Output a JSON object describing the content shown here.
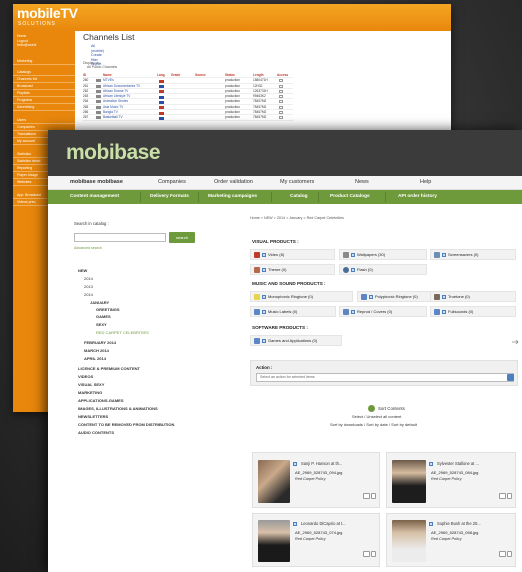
{
  "back_window": {
    "logo_main": "mobile",
    "logo_tv": "TV",
    "logo_sub": "SOLUTIONS",
    "side_top": [
      "Home",
      "Logout",
      "hello@world"
    ],
    "side_items": [
      "Marketing",
      "Catalogs",
      "Channels list",
      "Broadcast",
      "Playlists",
      "Programs",
      "Advertising",
      "Users",
      "Companies",
      "Translations",
      "My account",
      "Statistics",
      "Statistics detail",
      "Reporting",
      "Player Usage",
      "Websites",
      "App: Broadcast",
      "Videos prev."
    ],
    "page_title": "Channels List",
    "top_links": [
      "All (mobile)",
      "Create filter",
      "Export"
    ],
    "display_label": "Display on:",
    "display_value": "All Public Channels",
    "columns": [
      "ID",
      "Name",
      "Lang.",
      "Grade",
      "Source",
      "Status",
      "Length",
      "Access"
    ],
    "rows": [
      {
        "id": "260",
        "name": "MTV8's",
        "status": "production",
        "length": "1580471H"
      },
      {
        "id": "261",
        "name": "African Documentaries TV",
        "status": "production",
        "length": "12H32"
      },
      {
        "id": "262",
        "name": "African Drama TV",
        "status": "production",
        "length": "1263731H"
      },
      {
        "id": "263",
        "name": "African Lifestyle TV",
        "status": "production",
        "length": "99463K2"
      },
      {
        "id": "264",
        "name": "Animation Stories",
        "status": "production",
        "length": "78457M2"
      },
      {
        "id": "265",
        "name": "Asia Music TV",
        "status": "production",
        "length": "78457M2"
      },
      {
        "id": "266",
        "name": "Bangla TV",
        "status": "production",
        "length": "78457M2"
      },
      {
        "id": "267",
        "name": "Basketball TV",
        "status": "production",
        "length": "78457M2"
      }
    ]
  },
  "front_window": {
    "logo": "mobibase",
    "nav_top": [
      "mobibase mobibase",
      "Companies",
      "Order validation",
      "My customers",
      "News",
      "Help"
    ],
    "nav_green": [
      "Content management",
      "Delivery Formats",
      "Marketing campaigns",
      "Catalog",
      "Product Catalogs",
      "API order history"
    ],
    "search": {
      "label": "Search in catalog :",
      "button": "search",
      "advanced": "Advanced search"
    },
    "tree": {
      "new": "NEW",
      "y2014a": "2014",
      "y2013": "2013",
      "y2014b": "2014",
      "january": "JANUARY",
      "greetings": "GREETINGS",
      "games": "GAMES",
      "sexy": "SEXY",
      "red_carpet": "RED CARPET CELEBRITIES",
      "february": "FEBRUARY 2014",
      "march": "MARCH 2014",
      "april": "APRIL 2014",
      "licence": "LICENCE & PREMIUM CONTENT",
      "videos": "VIDEOS",
      "visual_sexy": "VISUAL SEXY",
      "marketing": "MARKETING",
      "applications": "APPLICATIONS-GAMES",
      "images": "IMAGES, ILLUSTRATIONS & ANIMATIONS",
      "newsletters": "NEWSLETTERS",
      "remove": "CONTENT TO BE REMOVED FROM DISTRIBUTION",
      "audio": "AUDIO CONTENTS"
    },
    "breadcrumb": "Home > NEW > 2014 > January > Red Carpet Celebrities",
    "sections": {
      "visual": "VISUAL PRODUCTS :",
      "music": "MUSIC AND SOUND PRODUCTS :",
      "software": "SOFTWARE PRODUCTS :"
    },
    "products": {
      "video": "Video (8)",
      "wallpapers": "Wallpapers (30)",
      "screensavers": "Screensavers (0)",
      "theme": "Theme (0)",
      "flash": "Flash (0)",
      "monophonic": "Monophonic Ringtone (0)",
      "polyphonic": "Polyphonic Ringtone (0)",
      "truetone": "Truetone (0)",
      "music_labels": "Music Labels (0)",
      "reprod_covers": "Reprod / Covers (0)",
      "fullsounds": "Fullsounds (0)",
      "games_apps": "Games and Applications (0)"
    },
    "action": {
      "label": "Action :",
      "placeholder": "Select an action for selected items"
    },
    "sort": {
      "title": "Sort Contents",
      "select_links": "Select / Unselect all content",
      "sort_by": "Sort by downloads / Sort by date / Sort by default"
    },
    "cards": [
      {
        "title": "Sanji P. Hanson at th...",
        "id": "AE_2969_528743_094.jpg",
        "cat": "Red Carpet Policy"
      },
      {
        "title": "Sylvester Stallone at ...",
        "id": "AE_2969_528743_084.jpg",
        "cat": "Red Carpet Policy"
      },
      {
        "title": "Leonardo DiCaprio at t...",
        "id": "AE_2969_528743_074.jpg",
        "cat": "Red Carpet Policy"
      },
      {
        "title": "Sophie Bush at the 20...",
        "id": "AE_2969_528743_058.jpg",
        "cat": "Red Carpet Policy"
      }
    ]
  },
  "colors": {
    "orange": "#e8870c",
    "green": "#6f9a3c",
    "dark": "#3b3b3b"
  }
}
